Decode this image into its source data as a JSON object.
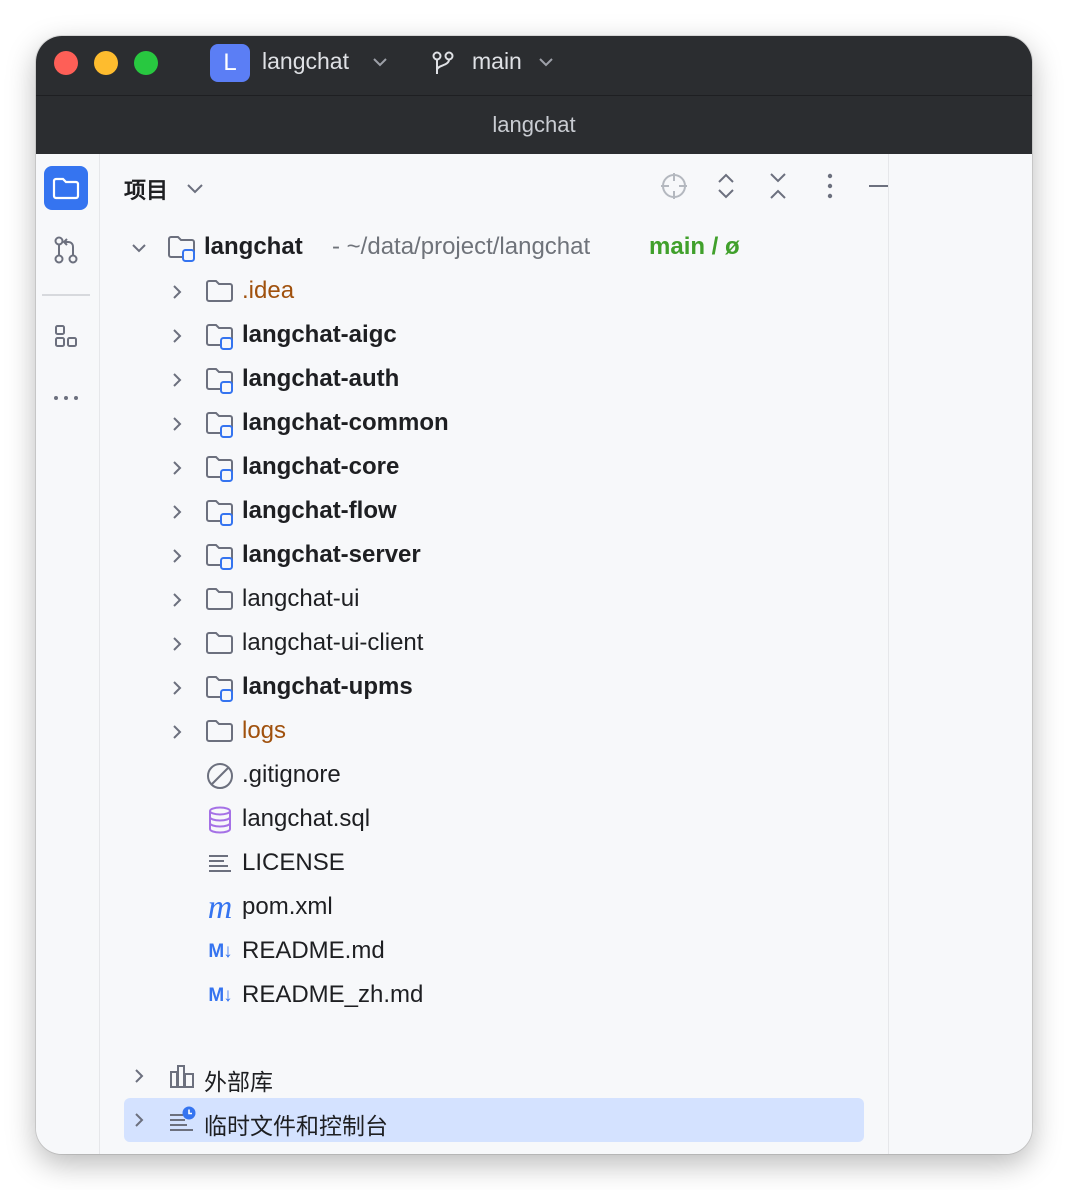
{
  "titlebar": {
    "project_badge": "L",
    "project_name": "langchat",
    "branch": "main"
  },
  "window_title": "langchat",
  "stripe": {
    "items": [
      {
        "icon": "folder-icon",
        "active": true
      },
      {
        "icon": "commit-icon",
        "active": false
      },
      {
        "icon": "structure-icon",
        "active": false
      },
      {
        "icon": "more-icon",
        "active": false
      }
    ]
  },
  "panel": {
    "title": "项目",
    "toolbar": [
      "locate-icon",
      "expand-all-icon",
      "collapse-all-icon",
      "options-icon",
      "hide-icon"
    ]
  },
  "tree": {
    "root": {
      "name": "langchat",
      "path": "- ~/data/project/langchat",
      "branch": "main / ø"
    },
    "children": [
      {
        "name": ".idea",
        "kind": "folder",
        "style": "excluded"
      },
      {
        "name": "langchat-aigc",
        "kind": "module",
        "style": "bold"
      },
      {
        "name": "langchat-auth",
        "kind": "module",
        "style": "bold"
      },
      {
        "name": "langchat-common",
        "kind": "module",
        "style": "bold"
      },
      {
        "name": "langchat-core",
        "kind": "module",
        "style": "bold"
      },
      {
        "name": "langchat-flow",
        "kind": "module",
        "style": "bold"
      },
      {
        "name": "langchat-server",
        "kind": "module",
        "style": "bold"
      },
      {
        "name": "langchat-ui",
        "kind": "folder",
        "style": "normal"
      },
      {
        "name": "langchat-ui-client",
        "kind": "folder",
        "style": "normal"
      },
      {
        "name": "langchat-upms",
        "kind": "module",
        "style": "bold"
      },
      {
        "name": "logs",
        "kind": "folder",
        "style": "excluded"
      },
      {
        "name": ".gitignore",
        "kind": "ignore-file",
        "style": "normal"
      },
      {
        "name": "langchat.sql",
        "kind": "sql-file",
        "style": "normal"
      },
      {
        "name": "LICENSE",
        "kind": "text-file",
        "style": "normal"
      },
      {
        "name": "pom.xml",
        "kind": "maven-file",
        "style": "normal"
      },
      {
        "name": "README.md",
        "kind": "markdown-file",
        "style": "normal"
      },
      {
        "name": "README_zh.md",
        "kind": "markdown-file",
        "style": "normal"
      }
    ],
    "external_libraries": "外部库",
    "scratches": "临时文件和控制台",
    "md_glyph": "M↓"
  },
  "colors": {
    "accent": "#3574f0",
    "excluded": "#a0510d",
    "branch": "#40a02b",
    "selection": "#d4e2ff"
  }
}
